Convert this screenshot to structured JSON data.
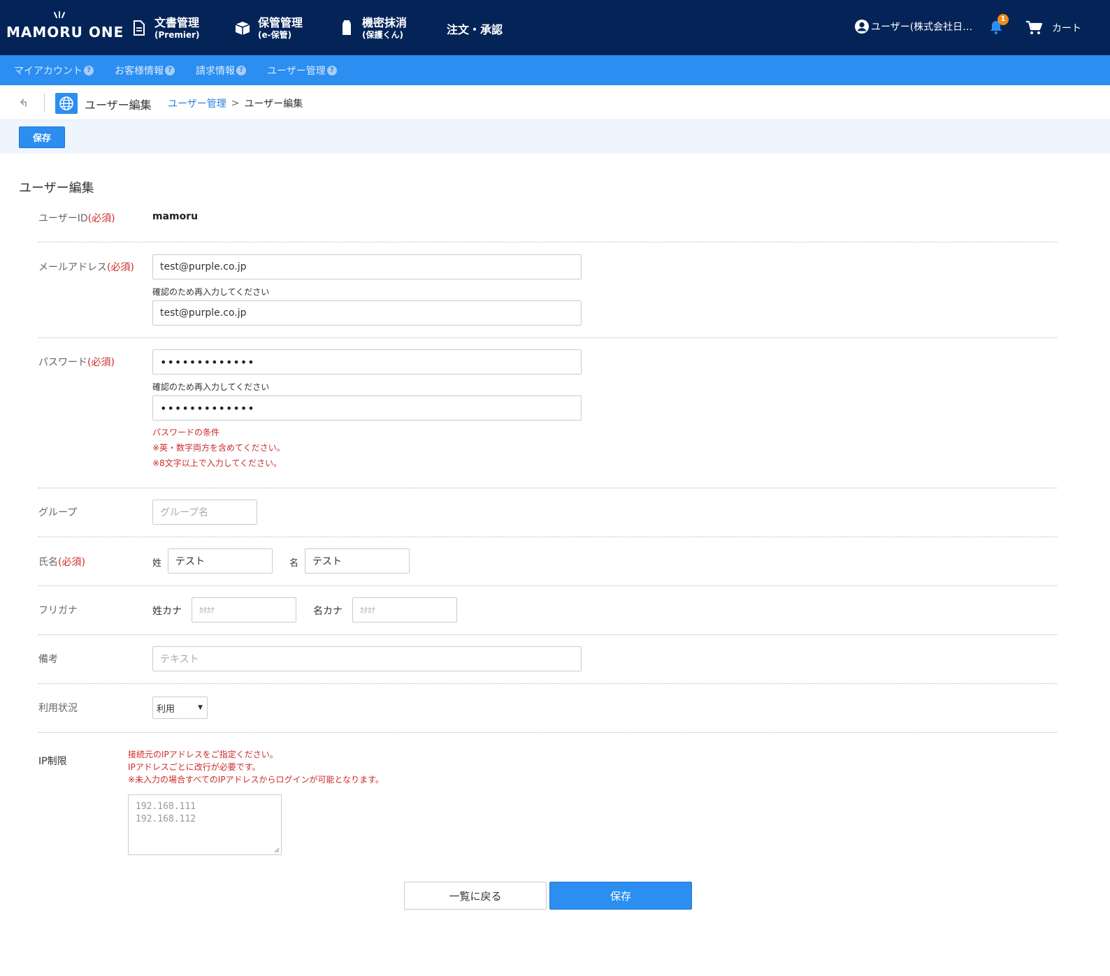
{
  "header": {
    "logo_text": "MAMORU ONE",
    "nav": [
      {
        "main": "文書管理",
        "sub": "(Premier)",
        "icon": "document-icon"
      },
      {
        "main": "保管管理",
        "sub": "(e-保管)",
        "icon": "box-icon"
      },
      {
        "main": "機密抹消",
        "sub": "(保護くん)",
        "icon": "shredder-icon"
      }
    ],
    "order_label": "注文・承認",
    "user_label": "ユーザー(株式会社日…",
    "notification_count": "1",
    "cart_label": "カート"
  },
  "subnav": {
    "items": [
      {
        "label": "マイアカウント"
      },
      {
        "label": "お客様情報"
      },
      {
        "label": "請求情報"
      },
      {
        "label": "ユーザー管理"
      }
    ],
    "help_glyph": "?"
  },
  "breadcrumb": {
    "page_title": "ユーザー編集",
    "parent": "ユーザー管理",
    "separator": ">",
    "current": "ユーザー編集"
  },
  "toolbar": {
    "save_label": "保存"
  },
  "form": {
    "section_title": "ユーザー編集",
    "required_mark": "(必須)",
    "user_id": {
      "label": "ユーザーID",
      "value": "mamoru"
    },
    "email": {
      "label": "メールアドレス",
      "value": "test@purple.co.jp",
      "confirm_helper": "確認のため再入力してください",
      "confirm_value": "test@purple.co.jp"
    },
    "password": {
      "label": "パスワード",
      "value": "•••••••••••••",
      "confirm_helper": "確認のため再入力してください",
      "confirm_value": "•••••••••••••",
      "rules_title": "パスワードの条件",
      "rule1": "※英・数字両方を含めてください。",
      "rule2": "※8文字以上で入力してください。"
    },
    "group": {
      "label": "グループ",
      "placeholder": "グループ名"
    },
    "name": {
      "label": "氏名",
      "last_label": "姓",
      "last_value": "テスト",
      "first_label": "名",
      "first_value": "テスト"
    },
    "furigana": {
      "label": "フリガナ",
      "last_label": "姓カナ",
      "last_placeholder": "ｶﾀｶﾅ",
      "first_label": "名カナ",
      "first_placeholder": "ｶﾀｶﾅ"
    },
    "notes": {
      "label": "備考",
      "placeholder": "テキスト"
    },
    "status": {
      "label": "利用状況",
      "selected": "利用"
    },
    "ip": {
      "label": "IP制限",
      "note1": "接続元のIPアドレスをご指定ください。",
      "note2": "IPアドレスごとに改行が必要です。",
      "note3": "※未入力の場合すべてのIPアドレスからログインが可能となります。",
      "placeholder_line1": "192.168.111",
      "placeholder_line2": "192.168.112"
    }
  },
  "actions": {
    "back_label": "一覧に戻る",
    "save_label": "保存"
  },
  "colors": {
    "header_bg": "#042458",
    "subnav_bg": "#2b8ef0",
    "accent": "#2b8ef0",
    "required": "#cc2a2a",
    "badge": "#f08b1a"
  }
}
